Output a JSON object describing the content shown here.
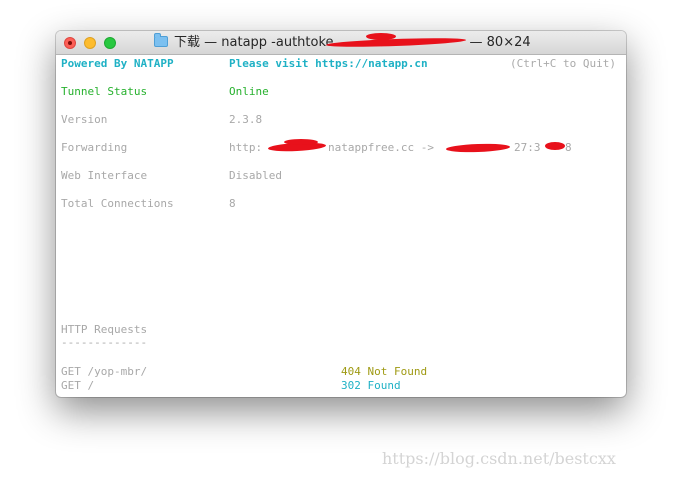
{
  "window": {
    "title_prefix": "下载 — natapp -authtoke",
    "title_suffix": "— 80×24"
  },
  "header": {
    "powered": "Powered By NATAPP",
    "visit": "Please visit https://natapp.cn",
    "quit_hint": "(Ctrl+C to Quit)"
  },
  "rows": {
    "tunnel_status": {
      "label": "Tunnel Status",
      "value": "Online"
    },
    "version": {
      "label": "Version",
      "value": "2.3.8"
    },
    "forwarding": {
      "label": "Forwarding",
      "value_a": "http:",
      "value_b": "natappfree.cc ->",
      "value_c": "27:3",
      "value_d": "8"
    },
    "web_interface": {
      "label": "Web Interface",
      "value": "Disabled"
    },
    "total_connections": {
      "label": "Total Connections",
      "value": "8"
    }
  },
  "http": {
    "heading": "HTTP Requests",
    "underline": "-------------",
    "requests": [
      {
        "path": "GET /yop-mbr/",
        "status": "404 Not Found"
      },
      {
        "path": "GET /",
        "status": "302 Found"
      }
    ]
  },
  "watermark": "https://blog.csdn.net/bestcxx",
  "colors": {
    "cyan": "#1fb1c5",
    "green": "#27b12e",
    "olive": "#9f9a13",
    "dim": "#a8a8a8",
    "redaction": "#e8111b"
  }
}
